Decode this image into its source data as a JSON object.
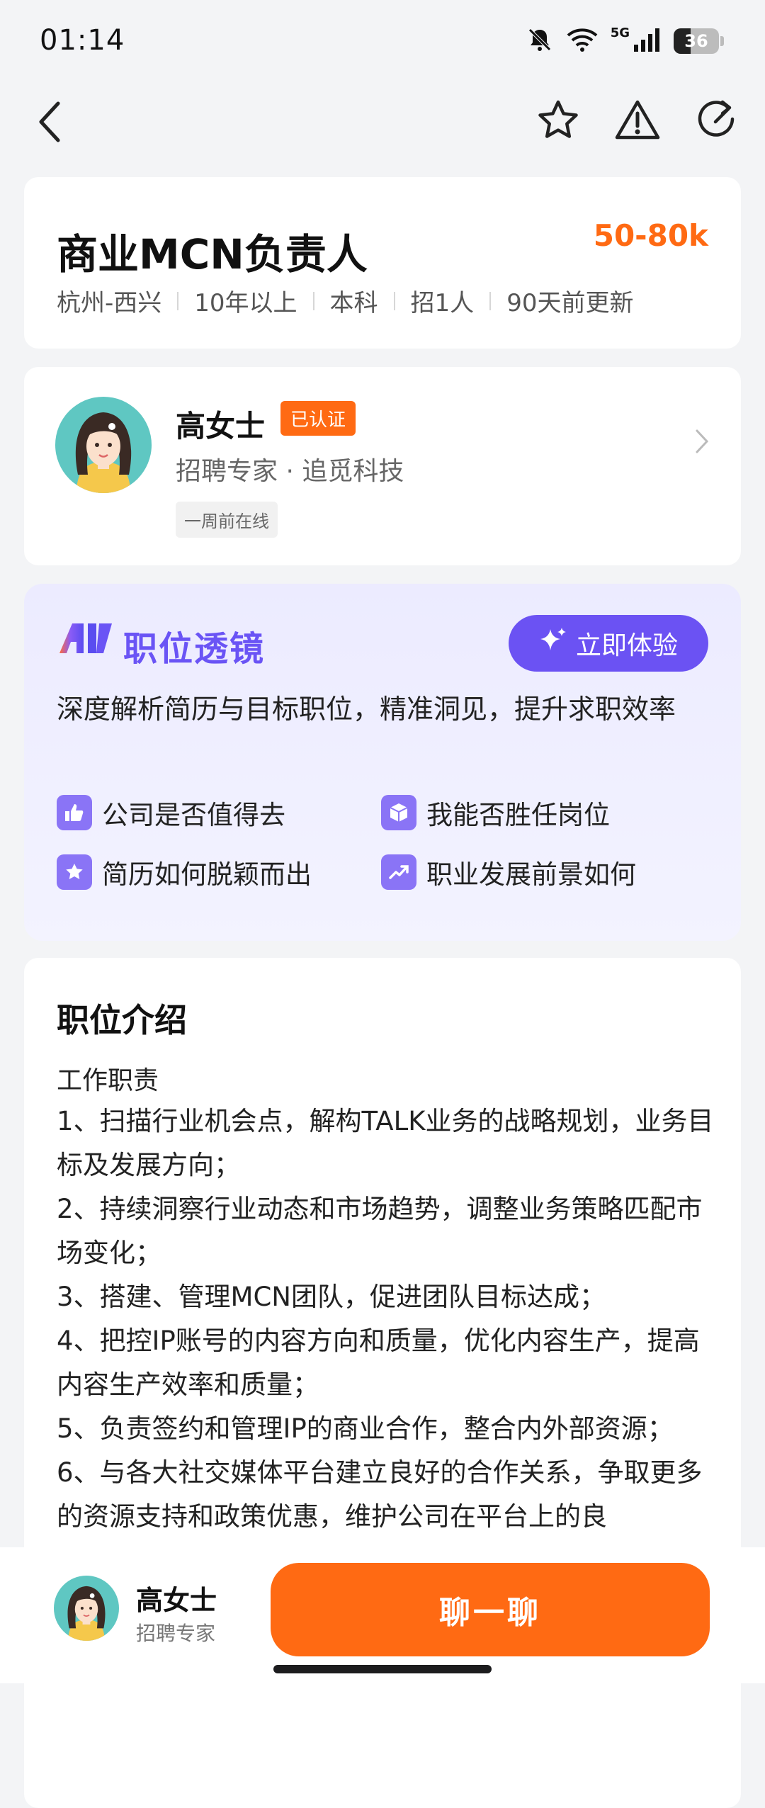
{
  "status_bar": {
    "time": "01:14",
    "network": "5G",
    "battery": "36"
  },
  "job": {
    "title": "商业MCN负责人",
    "salary": "50-80k",
    "meta": [
      "杭州-西兴",
      "10年以上",
      "本科",
      "招1人",
      "90天前更新"
    ]
  },
  "recruiter": {
    "name": "高女士",
    "badge": "已认证",
    "role": "招聘专家 · 追觅科技",
    "online": "一周前在线"
  },
  "ai_lens": {
    "title": "职位透镜",
    "button": "立即体验",
    "desc": "深度解析简历与目标职位，精准洞见，提升求职效率",
    "features": [
      "公司是否值得去",
      "我能否胜任岗位",
      "简历如何脱颖而出",
      "职业发展前景如何"
    ]
  },
  "job_desc": {
    "title": "职位介绍",
    "heading": "工作职责",
    "lines": [
      "1、扫描行业机会点，解构TALK业务的战略规划，业务目标及发展方向；",
      "2、持续洞察行业动态和市场趋势，调整业务策略匹配市场变化；",
      "3、搭建、管理MCN团队，促进团队目标达成；",
      "4、把控IP账号的内容方向和质量，优化内容生产，提高内容生产效率和质量；",
      "5、负责签约和管理IP的商业合作，整合内外部资源；",
      "6、与各大社交媒体平台建立良好的合作关系，争取更多的资源支持和政策优惠，维护公司在平台上的良"
    ]
  },
  "bottom": {
    "name": "高女士",
    "role": "招聘专家",
    "cta": "聊一聊"
  },
  "colors": {
    "accent": "#ff6a13",
    "ai_purple": "#6b52f3"
  }
}
